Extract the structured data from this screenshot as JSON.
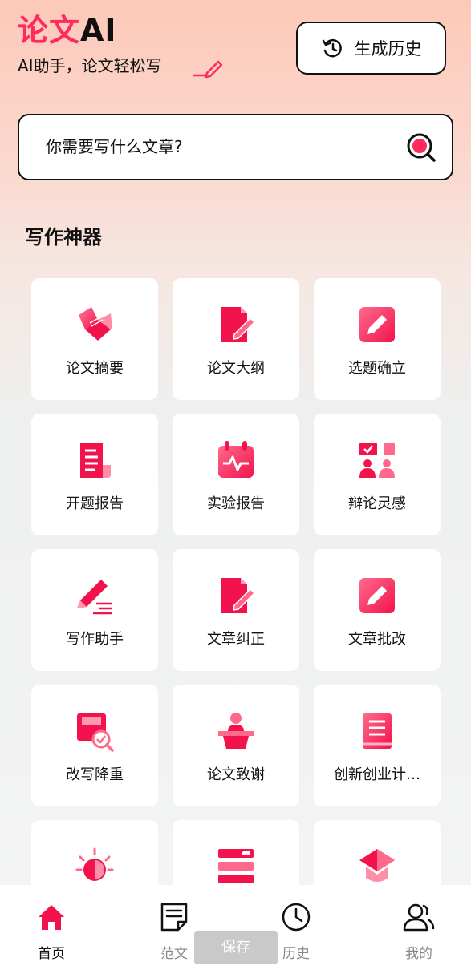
{
  "header": {
    "brand_part1": "论文",
    "brand_part2": "AI",
    "tagline": "AI助手，论文轻松写",
    "history_button": "生成历史"
  },
  "search": {
    "placeholder": "你需要写什么文章?"
  },
  "section_title": "写作神器",
  "tools": [
    {
      "label": "论文摘要",
      "icon": "book-icon"
    },
    {
      "label": "论文大纲",
      "icon": "document-edit-icon"
    },
    {
      "label": "选题确立",
      "icon": "pencil-square-icon"
    },
    {
      "label": "开题报告",
      "icon": "scroll-report-icon"
    },
    {
      "label": "实验报告",
      "icon": "calendar-pulse-icon"
    },
    {
      "label": "辩论灵感",
      "icon": "debate-icon"
    },
    {
      "label": "写作助手",
      "icon": "pen-lines-icon"
    },
    {
      "label": "文章纠正",
      "icon": "document-edit-icon"
    },
    {
      "label": "文章批改",
      "icon": "pencil-square-icon"
    },
    {
      "label": "改写降重",
      "icon": "box-search-icon"
    },
    {
      "label": "论文致谢",
      "icon": "podium-speaker-icon"
    },
    {
      "label": "创新创业计…",
      "icon": "notebook-icon"
    },
    {
      "label": "",
      "icon": "lightbulb-icon"
    },
    {
      "label": "",
      "icon": "stack-layers-icon"
    },
    {
      "label": "",
      "icon": "graduation-cap-icon"
    }
  ],
  "tabbar": {
    "home": "首页",
    "samples": "范文",
    "history": "历史",
    "mine": "我的"
  },
  "save_tip": "保存",
  "colors": {
    "accent": "#ff2a5e",
    "accent_light": "#ff6b8b"
  }
}
